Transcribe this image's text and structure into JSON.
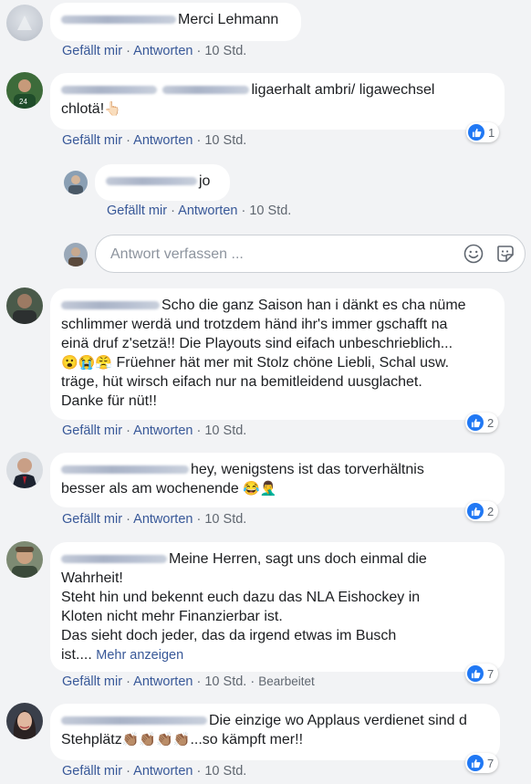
{
  "comments": [
    {
      "text": "Merci Lehmann",
      "like": "Gefällt mir",
      "reply": "Antworten",
      "time": "10 Std."
    },
    {
      "line1": "ligaerhalt ambri/ ligawechsel",
      "line2": "chlotä!",
      "emoji": "👆🏻",
      "like": "Gefällt mir",
      "reply": "Antworten",
      "time": "10 Std.",
      "reactions": "1"
    },
    {
      "text": "jo",
      "like": "Gefällt mir",
      "reply": "Antworten",
      "time": "10 Std."
    },
    {
      "lines": [
        "Scho die ganz Saison han i dänkt es cha nüme",
        "schlimmer werdä und trotzdem händ ihr's immer gschafft na",
        "einä druf z'setzä!! Die Playouts sind eifach unbeschrieblich...",
        "Früehner hät mer mit Stolz chöne Liebli, Schal usw.",
        "träge, hüt wirsch eifach nur na bemitleidend uusglachet.",
        "Danke für nüt!!"
      ],
      "emojis": "😮😭😤",
      "like": "Gefällt mir",
      "reply": "Antworten",
      "time": "10 Std.",
      "reactions": "2"
    },
    {
      "line1": "hey, wenigstens ist das torverhältnis",
      "line2": "besser als am wochenende",
      "emojis": "😂🤦‍♂️",
      "like": "Gefällt mir",
      "reply": "Antworten",
      "time": "10 Std.",
      "reactions": "2"
    },
    {
      "lines": [
        "Meine Herren, sagt uns doch einmal die",
        "Wahrheit!",
        "Steht hin und bekennt euch dazu das NLA Eishockey in",
        "Kloten nicht mehr Finanzierbar ist.",
        "Das sieht doch jeder, das da irgend etwas im Busch",
        "ist...."
      ],
      "more": "Mehr anzeigen",
      "like": "Gefällt mir",
      "reply": "Antworten",
      "time": "10 Std.",
      "edited": "Bearbeitet",
      "reactions": "7"
    },
    {
      "line1": "Die einzige wo Applaus verdienet sind d",
      "line2a": "Stehplätz",
      "claps": "👏🏽👏🏽👏🏽👏🏽",
      "line2b": "...so kämpft mer!!",
      "like": "Gefällt mir",
      "reply": "Antworten",
      "time": "10 Std.",
      "reactions": "7"
    }
  ],
  "reply_box": {
    "placeholder": "Antwort verfassen ..."
  },
  "icons": {
    "emoji": "smiley-icon",
    "sticker": "sticker-icon",
    "like": "thumbs-up-icon"
  },
  "colors": {
    "link": "#385898",
    "meta": "#606770",
    "like_blue": "#2078f4",
    "background": "#f2f3f5"
  }
}
